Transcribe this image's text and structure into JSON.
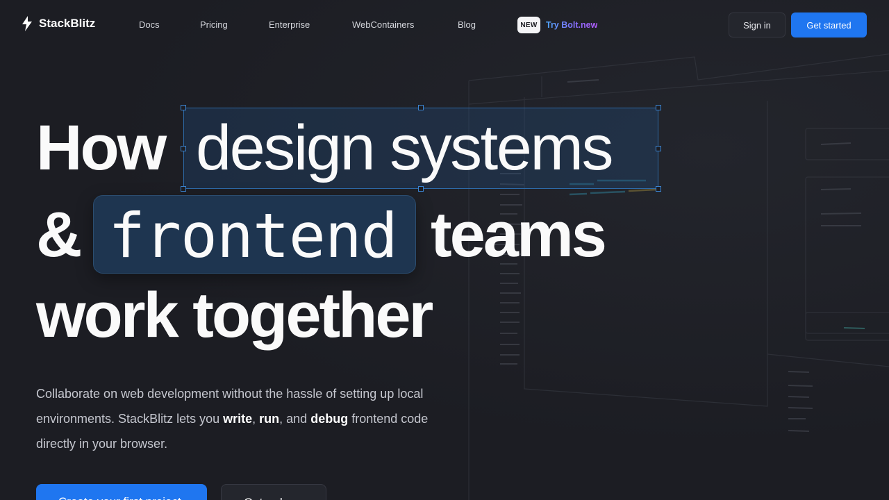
{
  "nav": {
    "brand": "StackBlitz",
    "links": [
      "Docs",
      "Pricing",
      "Enterprise",
      "WebContainers",
      "Blog"
    ],
    "new_badge": "NEW",
    "try_bolt": "Try Bolt.new",
    "sign_in": "Sign in",
    "get_started": "Get started"
  },
  "hero": {
    "line1_a": "How",
    "line1_b": "design systems",
    "line2_a": "&",
    "line2_b": "frontend",
    "line2_c": "teams",
    "line3": "work together",
    "desc_1": "Collaborate on web development without the hassle of setting up local environments. StackBlitz lets you ",
    "desc_write": "write",
    "desc_2": ", ",
    "desc_run": "run",
    "desc_3": ", and ",
    "desc_debug": "debug",
    "desc_4": " frontend code directly in your browser.",
    "cta_primary": "Create your first project",
    "cta_secondary": "Get a demo"
  },
  "colors": {
    "background": "#1c1d23",
    "accent": "#1f76f0",
    "selection": "#2d6aa8"
  }
}
